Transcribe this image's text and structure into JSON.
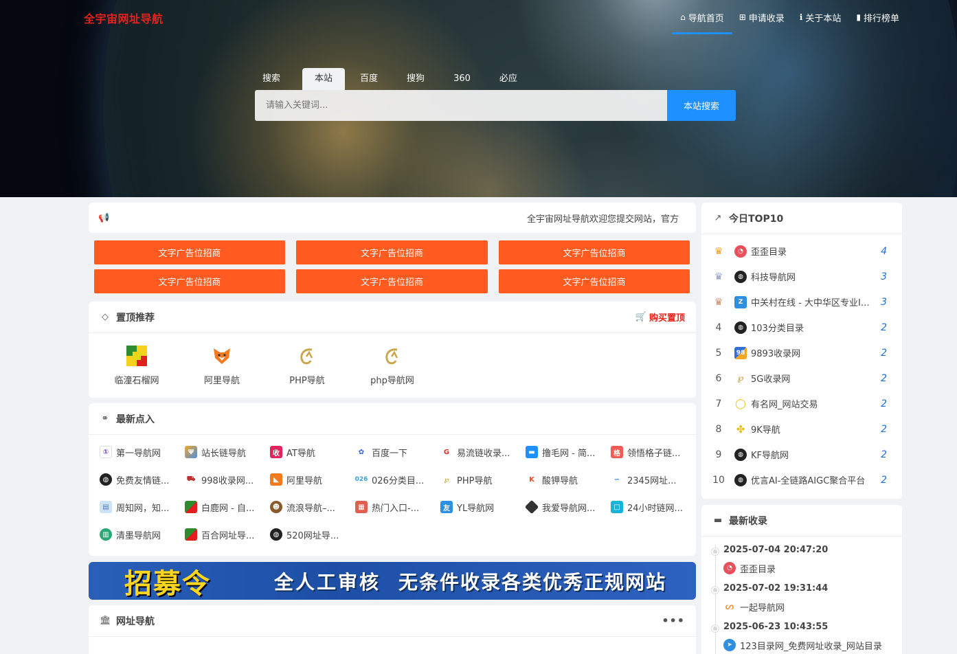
{
  "brand": "全宇宙网址导航",
  "topnav": [
    {
      "icon": "home-icon",
      "glyph": "⌂",
      "label": "导航首页"
    },
    {
      "icon": "plus-square-icon",
      "glyph": "⊞",
      "label": "申请收录"
    },
    {
      "icon": "info-icon",
      "glyph": "ℹ",
      "label": "关于本站"
    },
    {
      "icon": "bar-chart-icon",
      "glyph": "▮",
      "label": "排行榜单"
    }
  ],
  "search": {
    "tabs": [
      "搜索",
      "本站",
      "百度",
      "搜狗",
      "360",
      "必应"
    ],
    "placeholder": "请输入关键词...",
    "button": "本站搜索"
  },
  "notice": {
    "text": "全宇宙网址导航欢迎您提交网站，官方"
  },
  "ads": [
    "文字广告位招商",
    "文字广告位招商",
    "文字广告位招商",
    "文字广告位招商",
    "文字广告位招商",
    "文字广告位招商"
  ],
  "pinned": {
    "title": "置顶推荐",
    "buy": "购买置顶",
    "items": [
      "临潼石榴网",
      "阿里导航",
      "PHP导航",
      "php导航网"
    ]
  },
  "latest": {
    "title": "最新点入",
    "items": [
      "第一导航网",
      "站长链导航",
      "AT导航",
      "百度一下",
      "易流链收录...",
      "撸毛网 - 简...",
      "领悟格子链...",
      "免费友情链...",
      "998收录网...",
      "阿里导航",
      "026分类目...",
      "PHP导航",
      "酸钾导航",
      "2345网址...",
      "周知网，知...",
      "白鹿网 - 自...",
      "流浪导航–...",
      "热门入口-...",
      "YL导航网",
      "我爱导航网...",
      "24小时链网...",
      "清墨导航网",
      "百合网址导...",
      "520网址导..."
    ]
  },
  "banner": {
    "b1": "招募令",
    "b2": "全人工审核",
    "b3": "无条件收录各类优秀正规网站"
  },
  "nav": {
    "title": "网址导航",
    "more": "•••"
  },
  "top10": {
    "title": "今日TOP10",
    "rows": [
      {
        "rank": "1",
        "name": "歪歪目录",
        "count": "4"
      },
      {
        "rank": "2",
        "name": "科技导航网",
        "count": "3"
      },
      {
        "rank": "3",
        "name": "中关村在线 - 大中华区专业IT网站",
        "count": "3"
      },
      {
        "rank": "4",
        "name": "103分类目录",
        "count": "2"
      },
      {
        "rank": "5",
        "name": "9893收录网",
        "count": "2"
      },
      {
        "rank": "6",
        "name": "5G收录网",
        "count": "2"
      },
      {
        "rank": "7",
        "name": "有名网_网站交易",
        "count": "2"
      },
      {
        "rank": "8",
        "name": "9K导航",
        "count": "2"
      },
      {
        "rank": "9",
        "name": "KF导航网",
        "count": "2"
      },
      {
        "rank": "10",
        "name": "优言AI-全链路AIGC聚合平台",
        "count": "2"
      }
    ]
  },
  "recent": {
    "title": "最新收录",
    "items": [
      {
        "time": "2025-07-04 20:47:20",
        "name": "歪歪目录"
      },
      {
        "time": "2025-07-02 19:31:44",
        "name": "一起导航网"
      },
      {
        "time": "2025-06-23 10:43:55",
        "name": "123目录网_免费网址收录_网站目录"
      }
    ]
  }
}
